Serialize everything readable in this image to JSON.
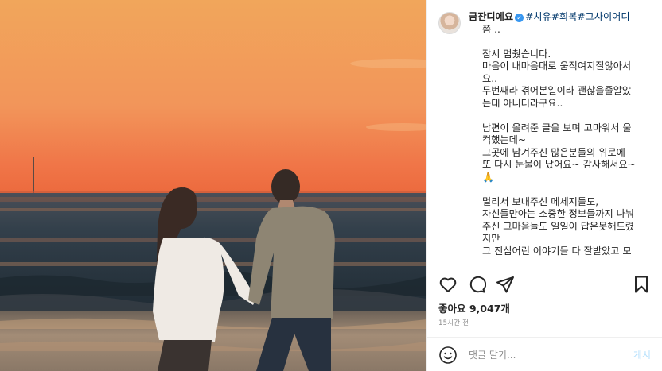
{
  "photo": {
    "alt": "",
    "colors": {
      "sky_top": "#f0a25a",
      "sky_horizon": "#f06a3c",
      "sea": "#2b3640",
      "sand": "#8f7e6c"
    }
  },
  "caption": {
    "username": "금잔디에요",
    "verified_icon": "verified-badge-icon",
    "hashtags": "#치유#회복#그사이어디",
    "lines": [
      "쯤 ..",
      "",
      "잠시 멈췄습니다.",
      "마음이 내마음대로 움직여지질않아서",
      "요..",
      "두번째라 겪어본일이라 괜찮을줄알았",
      "는데 아니더라구요..",
      "",
      "남편이 올려준 글을 보며 고마워서 울",
      "컥했는데~",
      "그곳에 남겨주신 많은분들의 위로에",
      "또 다시 눈물이 났어요~ 감사해서요~",
      "🙏",
      "",
      "멀리서 보내주신 메세지들도,",
      "자신들만아는 소중한 정보들까지 나눠",
      "주신 그마음들도 일일이 답은못해드렸",
      "지만",
      "그 진심어린 이야기들 다 잘받았고 모"
    ]
  },
  "actions": {
    "like_icon": "heart-icon",
    "comment_icon": "comment-icon",
    "share_icon": "paper-plane-icon",
    "save_icon": "bookmark-icon"
  },
  "likes": {
    "label": "좋아요 9,047개"
  },
  "timestamp": "15시간 전",
  "comment": {
    "emoji_icon": "smiley-icon",
    "placeholder": "댓글 달기...",
    "post_label": "게시"
  }
}
